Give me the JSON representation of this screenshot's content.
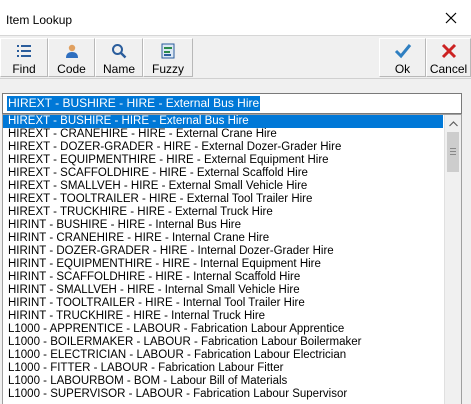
{
  "window": {
    "title": "Item Lookup"
  },
  "toolbar": {
    "find": "Find",
    "code": "Code",
    "name": "Name",
    "fuzzy": "Fuzzy",
    "ok": "Ok",
    "cancel": "Cancel"
  },
  "colors": {
    "selection": "#0078d7",
    "ok_accent": "#2f7fc1",
    "cancel_accent": "#cc2222"
  },
  "search": {
    "value": "HIREXT - BUSHIRE - HIRE - External Bus Hire"
  },
  "list": {
    "selected_index": 0,
    "items": [
      "HIREXT - BUSHIRE - HIRE - External Bus Hire",
      "HIREXT - CRANEHIRE - HIRE - External Crane Hire",
      "HIREXT - DOZER-GRADER - HIRE - External Dozer-Grader Hire",
      "HIREXT - EQUIPMENTHIRE - HIRE - External Equipment Hire",
      "HIREXT - SCAFFOLDHIRE - HIRE - External Scaffold Hire",
      "HIREXT - SMALLVEH - HIRE - External Small Vehicle Hire",
      "HIREXT - TOOLTRAILER - HIRE - External Tool Trailer Hire",
      "HIREXT - TRUCKHIRE - HIRE - External Truck Hire",
      "HIRINT - BUSHIRE - HIRE - Internal Bus Hire",
      "HIRINT - CRANEHIRE - HIRE - Internal Crane Hire",
      "HIRINT - DOZER-GRADER - HIRE - Internal Dozer-Grader Hire",
      "HIRINT - EQUIPMENTHIRE - HIRE - Internal Equipment Hire",
      "HIRINT - SCAFFOLDHIRE - HIRE - Internal Scaffold Hire",
      "HIRINT - SMALLVEH - HIRE - Internal Small Vehicle Hire",
      "HIRINT - TOOLTRAILER - HIRE - Internal Tool Trailer Hire",
      "HIRINT - TRUCKHIRE - HIRE - Internal Truck Hire",
      "L1000 - APPRENTICE - LABOUR - Fabrication Labour Apprentice",
      "L1000 - BOILERMAKER - LABOUR - Fabrication Labour Boilermaker",
      "L1000 - ELECTRICIAN - LABOUR - Fabrication Labour Electrician",
      "L1000 - FITTER - LABOUR - Fabrication Labour Fitter",
      "L1000 - LABOURBOM - BOM - Labour Bill of Materials",
      "L1000 - SUPERVISOR - LABOUR - Fabrication Labour Supervisor"
    ]
  }
}
